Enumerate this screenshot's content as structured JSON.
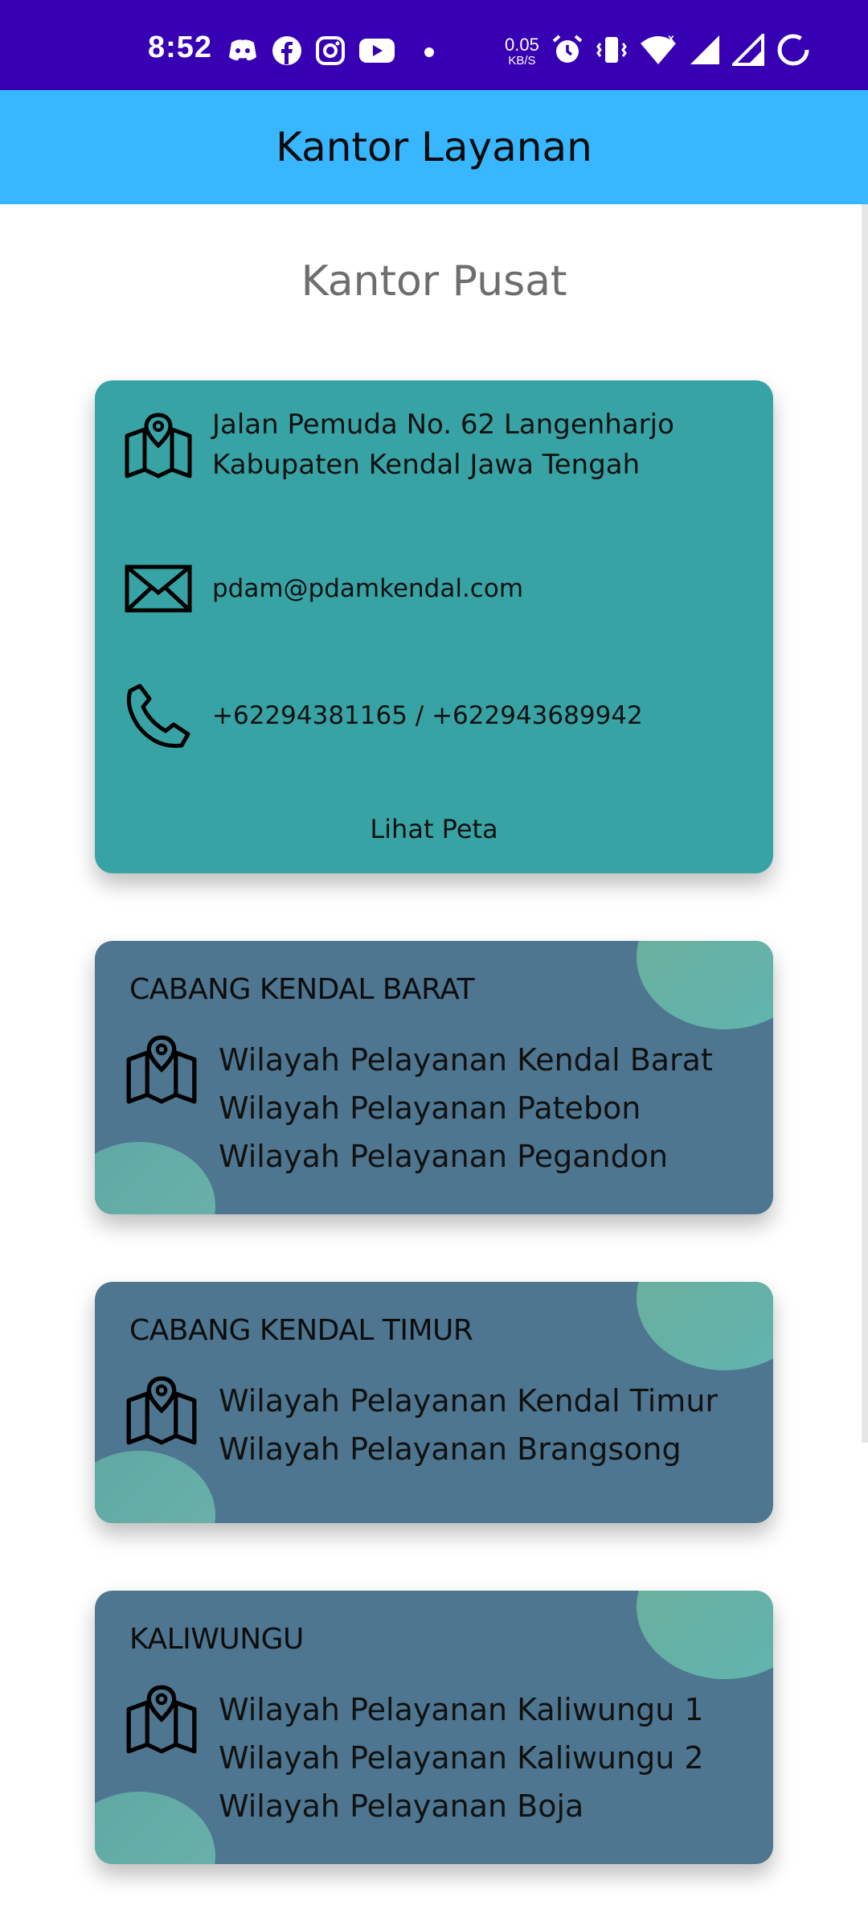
{
  "status_bar": {
    "time": "8:52",
    "net_speed_value": "0.05",
    "net_speed_unit": "KB/S",
    "icons_left": [
      "discord-icon",
      "facebook-icon",
      "instagram-icon",
      "youtube-icon",
      "dot-icon"
    ],
    "icons_right": [
      "alarm-icon",
      "vibrate-icon",
      "wifi-icon",
      "signal-icon",
      "signal-icon",
      "battery-icon"
    ]
  },
  "appbar": {
    "title": "Kantor Layanan"
  },
  "section_title": "Kantor Pusat",
  "main_office": {
    "address": [
      "Jalan Pemuda No. 62 Langenharjo",
      "Kabupaten Kendal Jawa Tengah"
    ],
    "email": "pdam@pdamkendal.com",
    "phone": "+62294381165 / +622943689942",
    "map_link": "Lihat Peta"
  },
  "branches": [
    {
      "title": "CABANG KENDAL BARAT",
      "items": [
        "Wilayah Pelayanan Kendal Barat",
        "Wilayah Pelayanan Patebon",
        "Wilayah Pelayanan Pegandon"
      ]
    },
    {
      "title": "CABANG KENDAL TIMUR",
      "items": [
        "Wilayah Pelayanan Kendal Timur",
        "Wilayah Pelayanan Brangsong"
      ]
    },
    {
      "title": "KALIWUNGU",
      "items": [
        "Wilayah Pelayanan Kaliwungu 1",
        "Wilayah Pelayanan Kaliwungu 2",
        "Wilayah Pelayanan Boja"
      ]
    }
  ],
  "colors": {
    "status_bar": "#3700b3",
    "appbar": "#38b6ff",
    "main_card": "#38a3a5",
    "branch_card": "#4e7690",
    "blob": "#66b0a6"
  }
}
